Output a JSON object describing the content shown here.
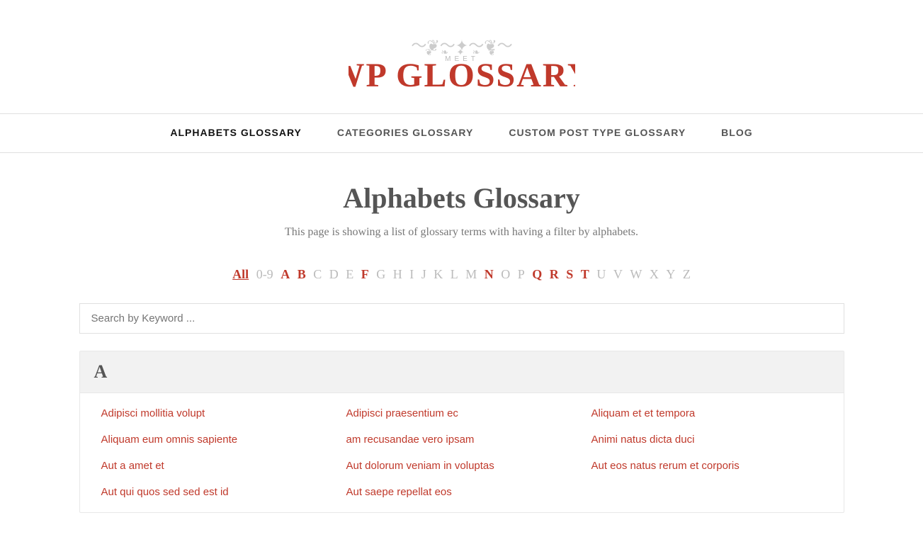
{
  "site": {
    "meet_label": "MEET",
    "logo_text": "WP GLOSSARY"
  },
  "nav": {
    "items": [
      {
        "label": "ALPHABETS GLOSSARY",
        "active": true
      },
      {
        "label": "CATEGORIES GLOSSARY",
        "active": false
      },
      {
        "label": "CUSTOM POST TYPE GLOSSARY",
        "active": false
      },
      {
        "label": "BLOG",
        "active": false
      }
    ]
  },
  "main": {
    "page_title": "Alphabets Glossary",
    "page_description": "This page is showing a list of glossary terms with having a filter by alphabets.",
    "alphabet_filter": {
      "all_label": "All",
      "num_label": "0-9",
      "letters_active": [
        "A",
        "B",
        "F",
        "N",
        "Q",
        "R",
        "S",
        "T"
      ],
      "letters_muted": [
        "C",
        "D",
        "E",
        "G",
        "H",
        "I",
        "J",
        "K",
        "L",
        "M",
        "O",
        "P",
        "U",
        "V",
        "W",
        "X",
        "Y",
        "Z"
      ]
    },
    "search": {
      "placeholder": "Search by Keyword ..."
    },
    "sections": [
      {
        "letter": "A",
        "terms": [
          "Adipisci mollitia volupt",
          "Adipisci praesentium ec",
          "Aliquam et et tempora",
          "Aliquam eum omnis sapiente",
          "am recusandae vero ipsam",
          "Animi natus dicta duci",
          "Aut a amet et",
          "Aut dolorum veniam in voluptas",
          "Aut eos natus rerum et corporis",
          "Aut qui quos sed sed est id",
          "Aut saepe repellat eos"
        ]
      }
    ]
  }
}
